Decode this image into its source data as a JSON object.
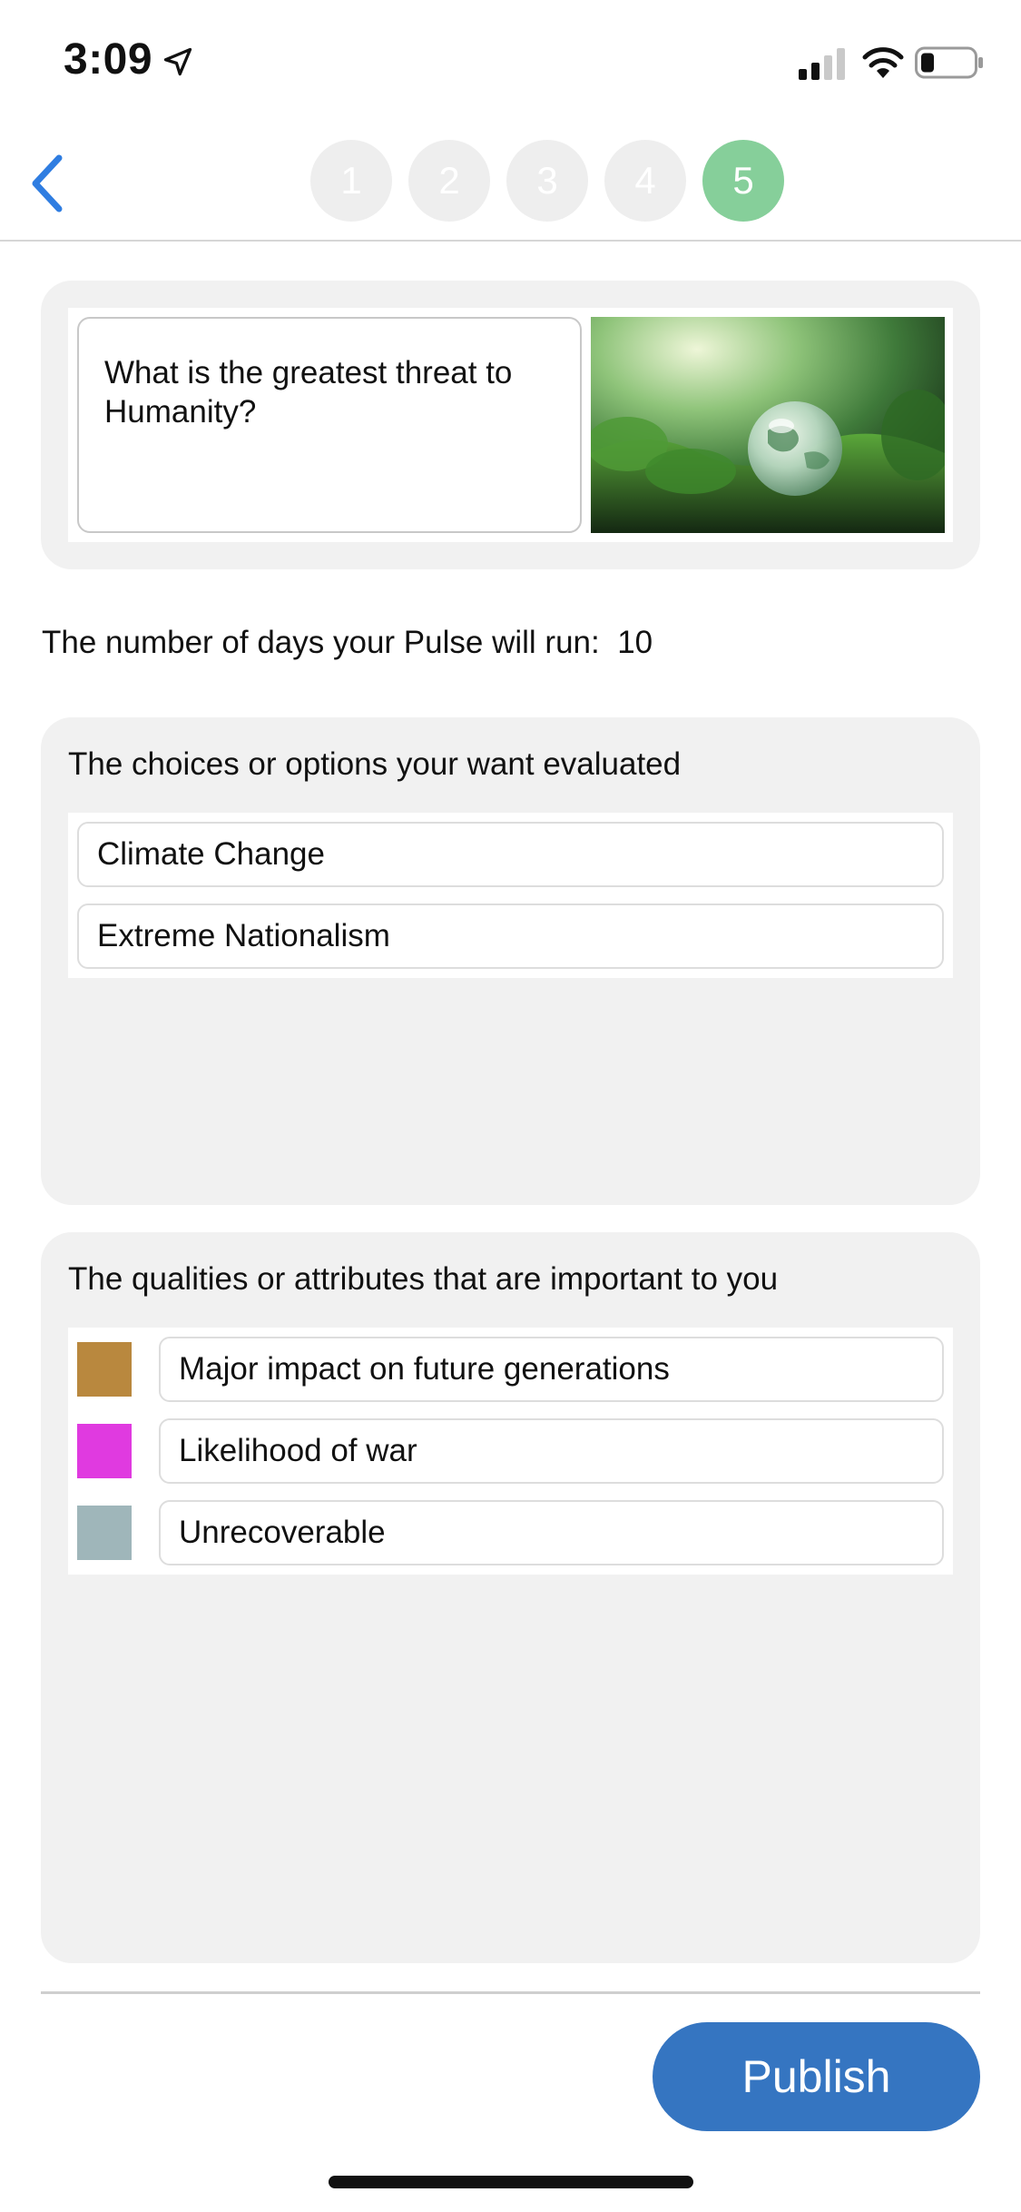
{
  "status_bar": {
    "time": "3:09"
  },
  "nav": {
    "steps": [
      "1",
      "2",
      "3",
      "4",
      "5"
    ],
    "active_step": "5",
    "step_inactive_color": "#eeeeee",
    "step_active_color": "#86cf9a"
  },
  "question": {
    "text": "What is the greatest threat to Humanity?"
  },
  "days": {
    "label": "The number of days your Pulse will run:",
    "value": "10"
  },
  "choices": {
    "title": "The choices or options your want evaluated",
    "items": [
      "Climate Change",
      "Extreme Nationalism"
    ]
  },
  "qualities": {
    "title": "The qualities or attributes that are important to you",
    "items": [
      {
        "label": "Major impact on future generations",
        "color": "#b9883e"
      },
      {
        "label": "Likelihood of war",
        "color": "#e03ae0"
      },
      {
        "label": "Unrecoverable",
        "color": "#9fb6ba"
      }
    ]
  },
  "actions": {
    "publish_label": "Publish",
    "publish_color": "#3575c1"
  }
}
